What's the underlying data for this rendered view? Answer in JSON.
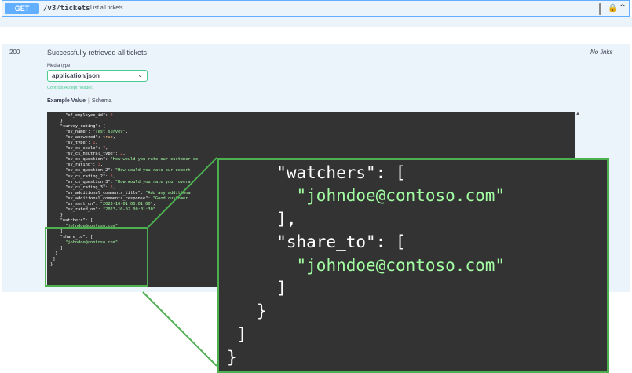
{
  "operation": {
    "method": "GET",
    "path": "/v3/tickets",
    "summary": "List all tickets"
  },
  "response": {
    "code": "200",
    "description": "Successfully retrieved all tickets",
    "links": "No links",
    "media_type_label": "Media type",
    "media_type_value": "application/json",
    "controls_note": "Controls Accept header.",
    "tab_example": "Example Value",
    "tab_schema": "Schema"
  },
  "code_lines": [
    [
      "      \"cf_employee_id\": ",
      "0",
      "num",
      ""
    ],
    [
      "    },",
      "",
      "",
      ""
    ],
    [
      "    \"survey_rating\": {",
      "",
      "",
      ""
    ],
    [
      "      \"sv_name\": ",
      "\"Test survey\"",
      "str",
      ","
    ],
    [
      "      \"sv_answered\": ",
      "true",
      "kw",
      ","
    ],
    [
      "      \"sv_type\": ",
      "1",
      "num",
      ","
    ],
    [
      "      \"sv_cs_scale\": ",
      "7",
      "num",
      ","
    ],
    [
      "      \"sv_cs_neutral_type\": ",
      "2",
      "num",
      ","
    ],
    [
      "      \"sv_cs_question\": ",
      "\"How would you rate our customer se",
      "str",
      ""
    ],
    [
      "      \"sv_rating\": ",
      "3",
      "num",
      ","
    ],
    [
      "      \"sv_cs_question_2\": ",
      "\"How would you rate our expert",
      "str",
      ""
    ],
    [
      "      \"sv_cs_rating_2\": ",
      "3",
      "num",
      ","
    ],
    [
      "      \"sv_cs_question_3\": ",
      "\"How would you rate your overa",
      "str",
      ""
    ],
    [
      "      \"sv_cs_rating_3\": ",
      "3",
      "num",
      ","
    ],
    [
      "      \"sv_additional_comments_title\": ",
      "\"Add any additiona",
      "str",
      ""
    ],
    [
      "      \"sv_additional_comments_response\": ",
      "\"Good customer",
      "str",
      ""
    ],
    [
      "      \"sv_sent_on\": ",
      "\"2023-10-01 00:01:00\"",
      "str",
      ","
    ],
    [
      "      \"sv_rated_on\": ",
      "\"2023-10-02 00:01:30\"",
      "str",
      ""
    ],
    [
      "    },",
      "",
      "",
      ""
    ],
    [
      "    \"watchers\": [",
      "",
      "",
      ""
    ],
    [
      "      ",
      "\"johndoe@contoso.com\"",
      "str",
      ""
    ],
    [
      "    ],",
      "",
      "",
      ""
    ],
    [
      "    \"share_to\": [",
      "",
      "",
      ""
    ],
    [
      "      ",
      "\"johndoe@contoso.com\"",
      "str",
      ""
    ],
    [
      "    ]",
      "",
      "",
      ""
    ],
    [
      "  }",
      "",
      "",
      ""
    ],
    [
      " ]",
      "",
      "",
      ""
    ],
    [
      "}",
      "",
      "",
      ""
    ]
  ],
  "zoom_lines": [
    [
      "     \"watchers\": [",
      "",
      "",
      ""
    ],
    [
      "       ",
      "\"johndoe@contoso.com\"",
      "str",
      ""
    ],
    [
      "     ],",
      "",
      "",
      ""
    ],
    [
      "     \"share_to\": [",
      "",
      "",
      ""
    ],
    [
      "       ",
      "\"johndoe@contoso.com\"",
      "str",
      ""
    ],
    [
      "     ]",
      "",
      "",
      ""
    ],
    [
      "   }",
      "",
      "",
      ""
    ],
    [
      " ]",
      "",
      "",
      ""
    ],
    [
      "}",
      "",
      "",
      ""
    ]
  ],
  "colors": {
    "get_blue": "#61affe",
    "success_green": "#49cc90",
    "highlight_green": "#4caf50",
    "code_bg": "#333333",
    "string_green": "#a2fca2",
    "number_red": "#d36363",
    "keyword_orange": "#fcc28c"
  },
  "icons": [
    "lock-icon",
    "chevron-up-icon",
    "chevron-down-icon"
  ]
}
